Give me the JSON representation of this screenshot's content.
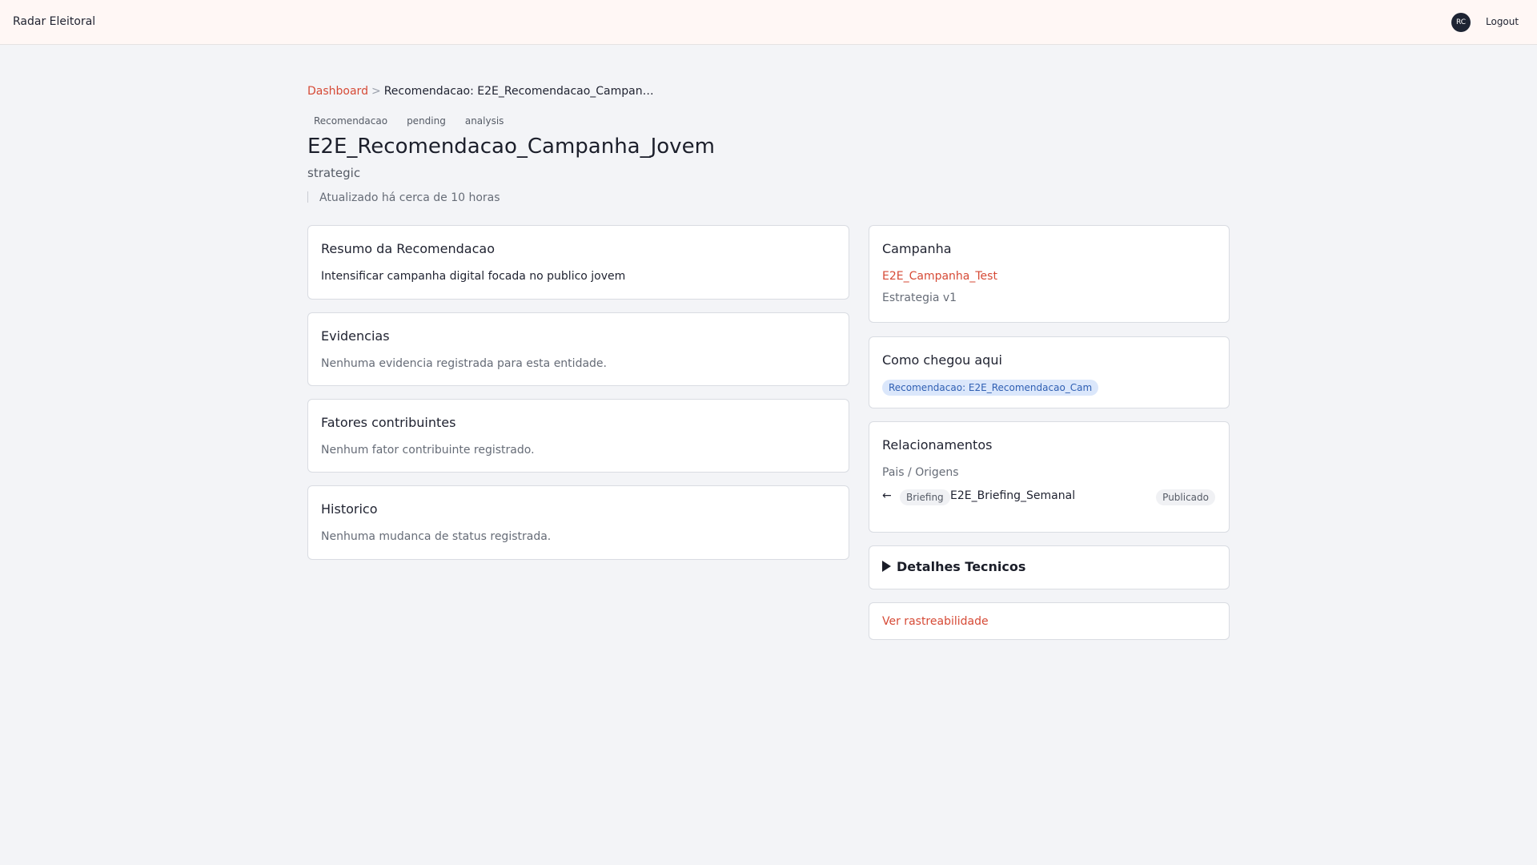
{
  "header": {
    "brand": "Radar Eleitoral",
    "avatar_initials": "RC",
    "logout_label": "Logout"
  },
  "breadcrumb": {
    "home": "Dashboard",
    "separator": ">",
    "current": "Recomendacao: E2E_Recomendacao_Campan…"
  },
  "tags": [
    "Recomendacao",
    "pending",
    "analysis"
  ],
  "entity": {
    "title": "E2E_Recomendacao_Campanha_Jovem",
    "subtitle": "strategic",
    "updated": "Atualizado há cerca de 10 horas"
  },
  "left_cards": {
    "summary": {
      "title": "Resumo da Recomendacao",
      "text": "Intensificar campanha digital focada no publico jovem"
    },
    "evidences": {
      "title": "Evidencias",
      "text": "Nenhuma evidencia registrada para esta entidade."
    },
    "factors": {
      "title": "Fatores contribuintes",
      "text": "Nenhum fator contribuinte registrado."
    },
    "history": {
      "title": "Historico",
      "text": "Nenhuma mudanca de status registrada."
    }
  },
  "right_cards": {
    "campaign": {
      "title": "Campanha",
      "link": "E2E_Campanha_Test",
      "strategy": "Estrategia v1"
    },
    "origin": {
      "title": "Como chegou aqui",
      "chip": "Recomendacao: E2E_Recomendacao_Cam"
    },
    "relations": {
      "title": "Relacionamentos",
      "section": "Pais / Origens",
      "arrow": "←",
      "items": [
        {
          "type": "Briefing",
          "name": "E2E_Briefing_Semanal",
          "status": "Publicado"
        }
      ]
    },
    "details": {
      "title": "Detalhes Tecnicos"
    },
    "trace": {
      "link": "Ver rastreabilidade"
    }
  },
  "colors": {
    "accent": "#d64a36",
    "chip_blue_bg": "#dbe7fb",
    "chip_blue_text": "#2f5fb3",
    "avatar_bg": "#1d2433"
  }
}
